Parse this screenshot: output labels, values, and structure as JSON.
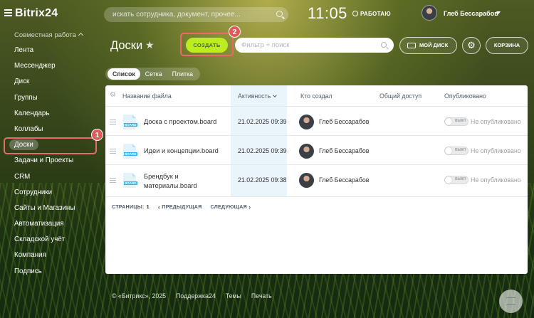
{
  "app": {
    "logo_text": "Bitrix24",
    "search_placeholder": "искать сотрудника, документ, прочее...",
    "clock": "11:05",
    "work_status": "РАБОТАЮ",
    "user_name": "Глеб Бессарабов"
  },
  "sidebar": {
    "section_label": "Совместная работа",
    "items": [
      {
        "label": "Лента"
      },
      {
        "label": "Мессенджер"
      },
      {
        "label": "Диск"
      },
      {
        "label": "Группы"
      },
      {
        "label": "Календарь"
      },
      {
        "label": "Коллабы"
      },
      {
        "label": "Доски",
        "active": true
      },
      {
        "label": "Задачи и Проекты"
      },
      {
        "label": "CRM"
      },
      {
        "label": "Сотрудники"
      },
      {
        "label": "Сайты и Магазины"
      },
      {
        "label": "Автоматизация"
      },
      {
        "label": "Складской учёт"
      },
      {
        "label": "Компания"
      },
      {
        "label": "Подпись"
      }
    ]
  },
  "toolbar": {
    "page_title": "Доски",
    "create_label": "СОЗДАТЬ",
    "filter_placeholder": "Фильтр + поиск",
    "my_disk_label": "МОЙ ДИСК",
    "trash_label": "КОРЗИНА"
  },
  "annotations": {
    "badge1": "1",
    "badge2": "2"
  },
  "view_tabs": [
    {
      "label": "Список",
      "active": true
    },
    {
      "label": "Сетка"
    },
    {
      "label": "Плитка"
    }
  ],
  "table": {
    "columns": {
      "name": "Название файла",
      "activity": "Активность",
      "creator": "Кто создал",
      "shared": "Общий доступ",
      "published": "Опубликовано"
    },
    "rows": [
      {
        "name": "Доска с проектом.board",
        "date": "21.02.2025 09:39",
        "creator": "Глеб Бессарабов",
        "toggle": "ВЫКЛ",
        "published": "Не опубликовано"
      },
      {
        "name": "Идеи и концепции.board",
        "date": "21.02.2025 09:39",
        "creator": "Глеб Бессарабов",
        "toggle": "ВЫКЛ",
        "published": "Не опубликовано"
      },
      {
        "name": "Брендбук и материалы.board",
        "date": "21.02.2025 09:38",
        "creator": "Глеб Бессарабов",
        "toggle": "ВЫКЛ",
        "published": "Не опубликовано"
      }
    ],
    "file_ext_label": "BOARD"
  },
  "pager": {
    "pages_label": "СТРАНИЦЫ:",
    "current_page": "1",
    "prev_label": "ПРЕДЫДУЩАЯ",
    "next_label": "СЛЕДУЮЩАЯ"
  },
  "footer": {
    "copyright": "© «Битрикс», 2025",
    "support": "Поддержка24",
    "themes": "Темы",
    "print": "Печать"
  },
  "colors": {
    "create_button": "#bbed21",
    "highlight": "#e86a6a",
    "active_column": "#eaf5fb"
  }
}
